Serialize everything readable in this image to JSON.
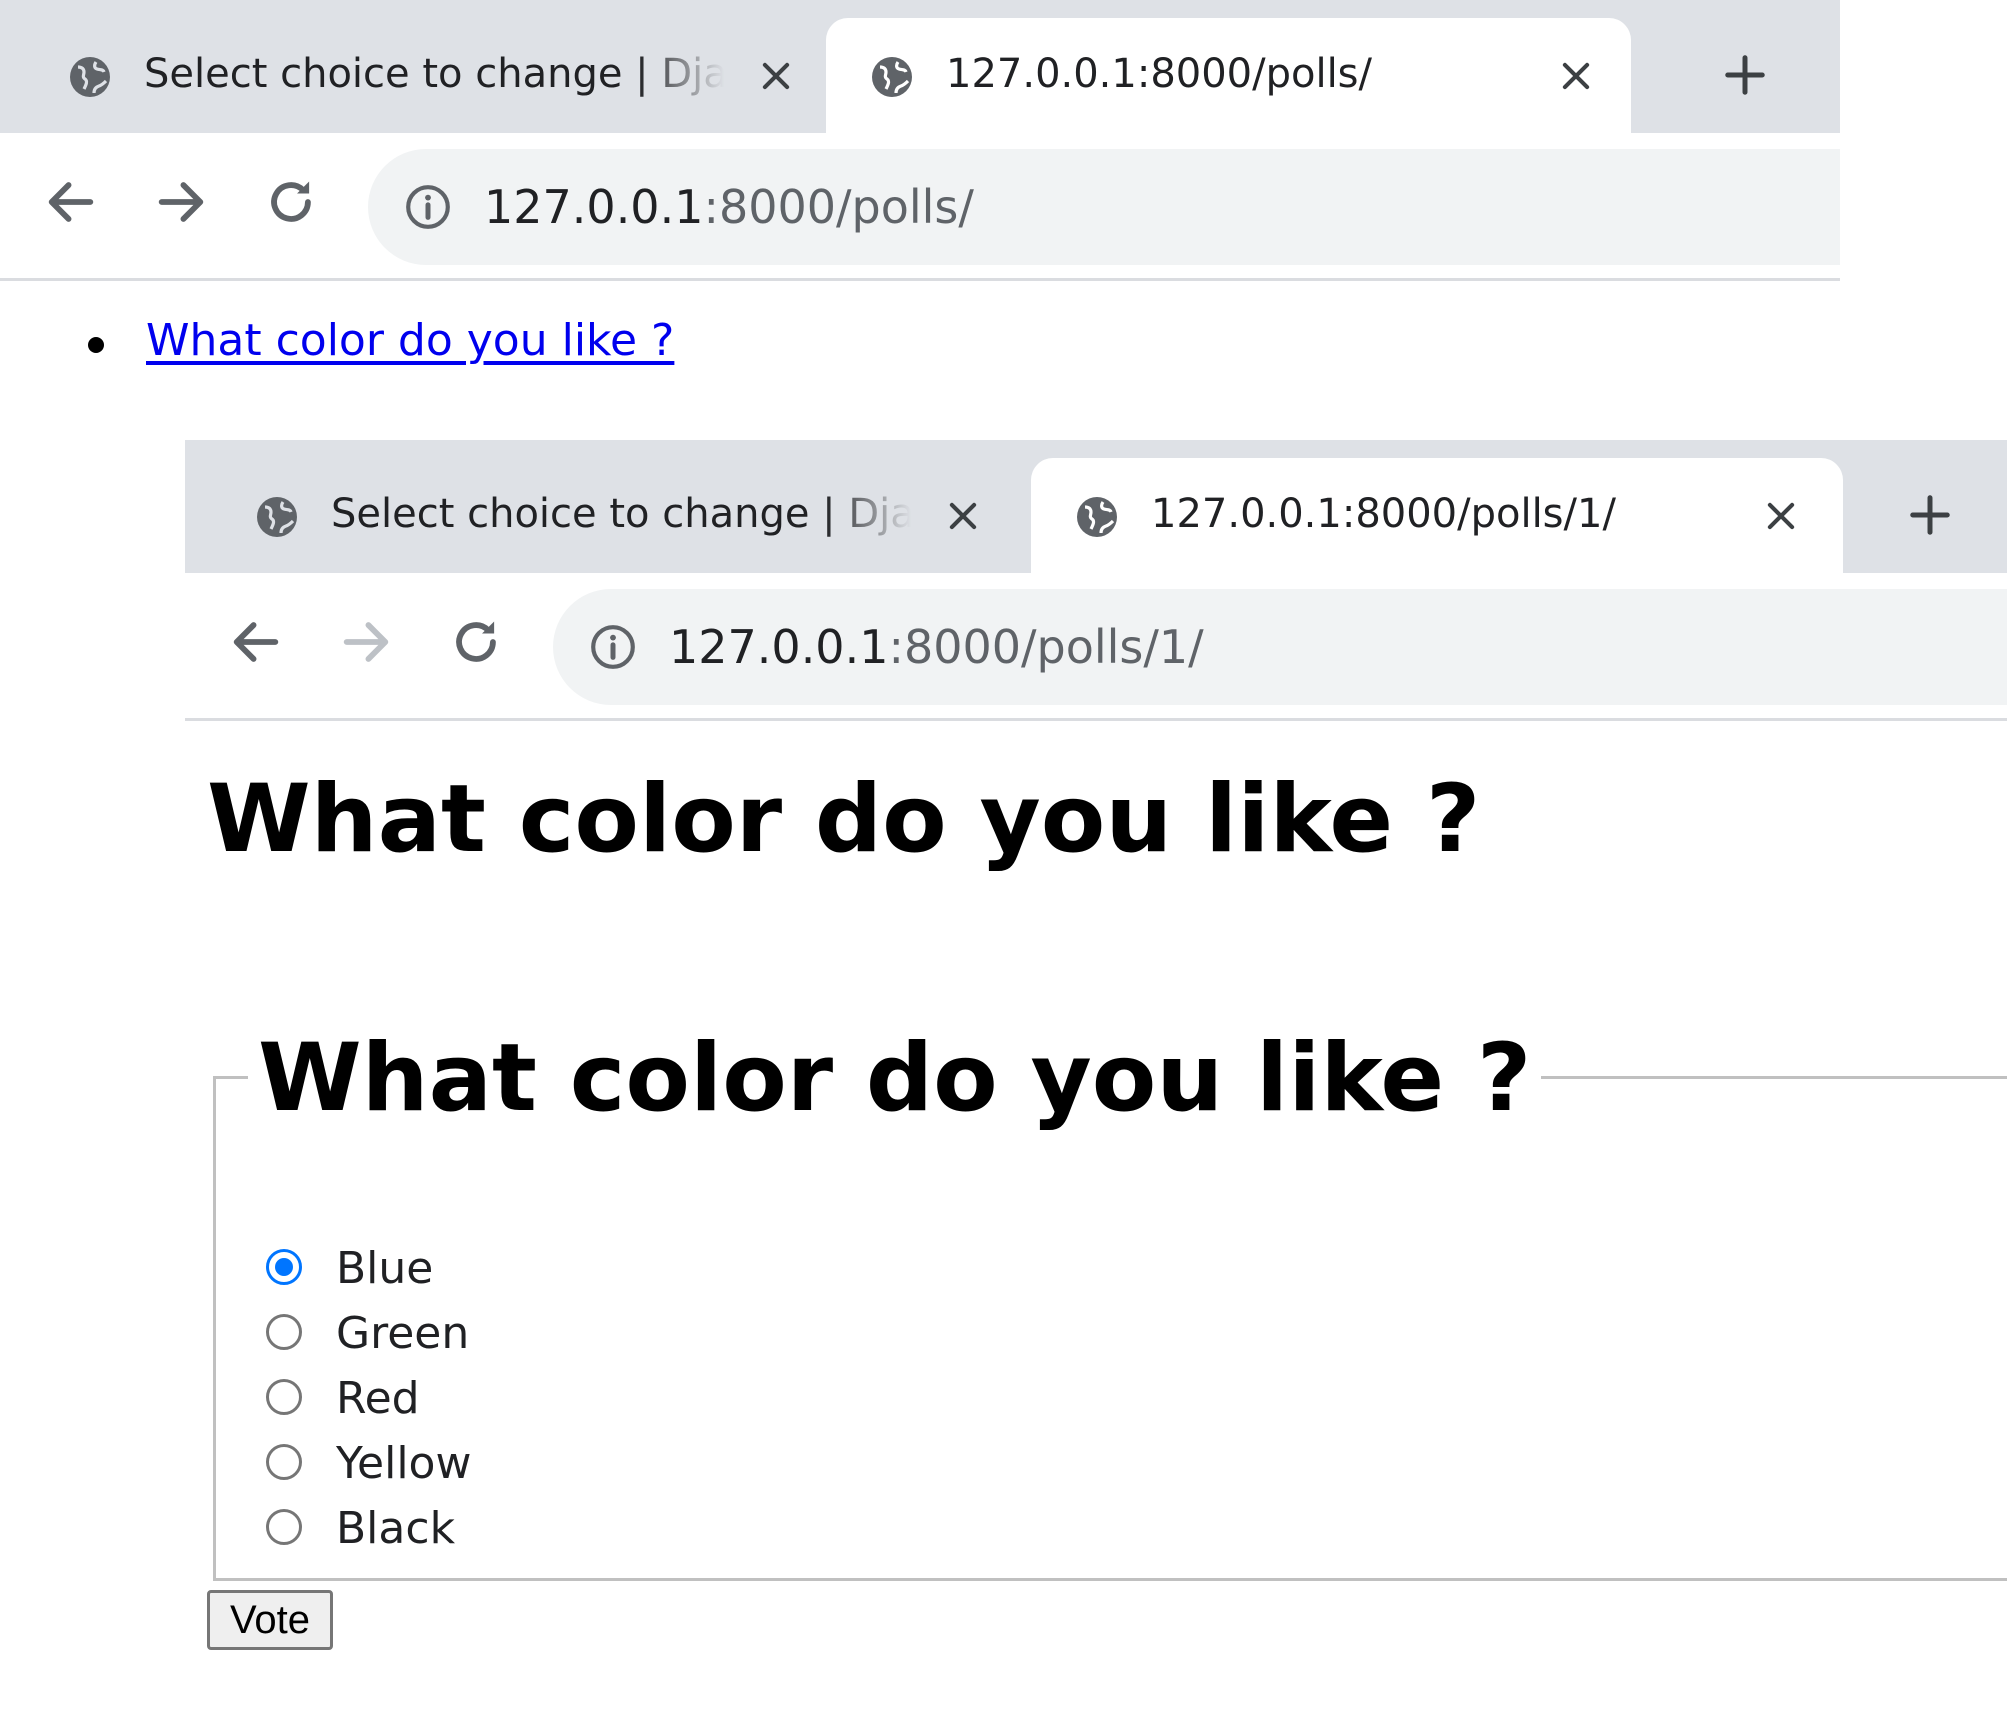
{
  "window1": {
    "tabs": [
      {
        "title": "Select choice to change | Django",
        "active": false
      },
      {
        "title": "127.0.0.1:8000/polls/",
        "active": true
      }
    ],
    "address": {
      "host": "127.0.0.1",
      "path": ":8000/polls/"
    },
    "page": {
      "poll_links": [
        "What color do you like ?"
      ]
    }
  },
  "window2": {
    "tabs": [
      {
        "title": "Select choice to change | Django",
        "active": false
      },
      {
        "title": "127.0.0.1:8000/polls/1/",
        "active": true
      }
    ],
    "address": {
      "host": "127.0.0.1",
      "path": ":8000/polls/1/"
    },
    "page": {
      "heading": "What color do you like ?",
      "legend": "What color do you like ?",
      "choices": [
        {
          "label": "Blue",
          "checked": true
        },
        {
          "label": "Green",
          "checked": false
        },
        {
          "label": "Red",
          "checked": false
        },
        {
          "label": "Yellow",
          "checked": false
        },
        {
          "label": "Black",
          "checked": false
        }
      ],
      "vote_label": "Vote"
    }
  },
  "colors": {
    "tabstrip": "#dee1e6",
    "omnibox": "#f1f3f4",
    "link": "#0000ee",
    "radio_checked": "#0075ff"
  },
  "icons": [
    "globe-icon",
    "close-icon",
    "new-tab-icon",
    "back-arrow-icon",
    "forward-arrow-icon",
    "reload-icon",
    "info-icon"
  ]
}
